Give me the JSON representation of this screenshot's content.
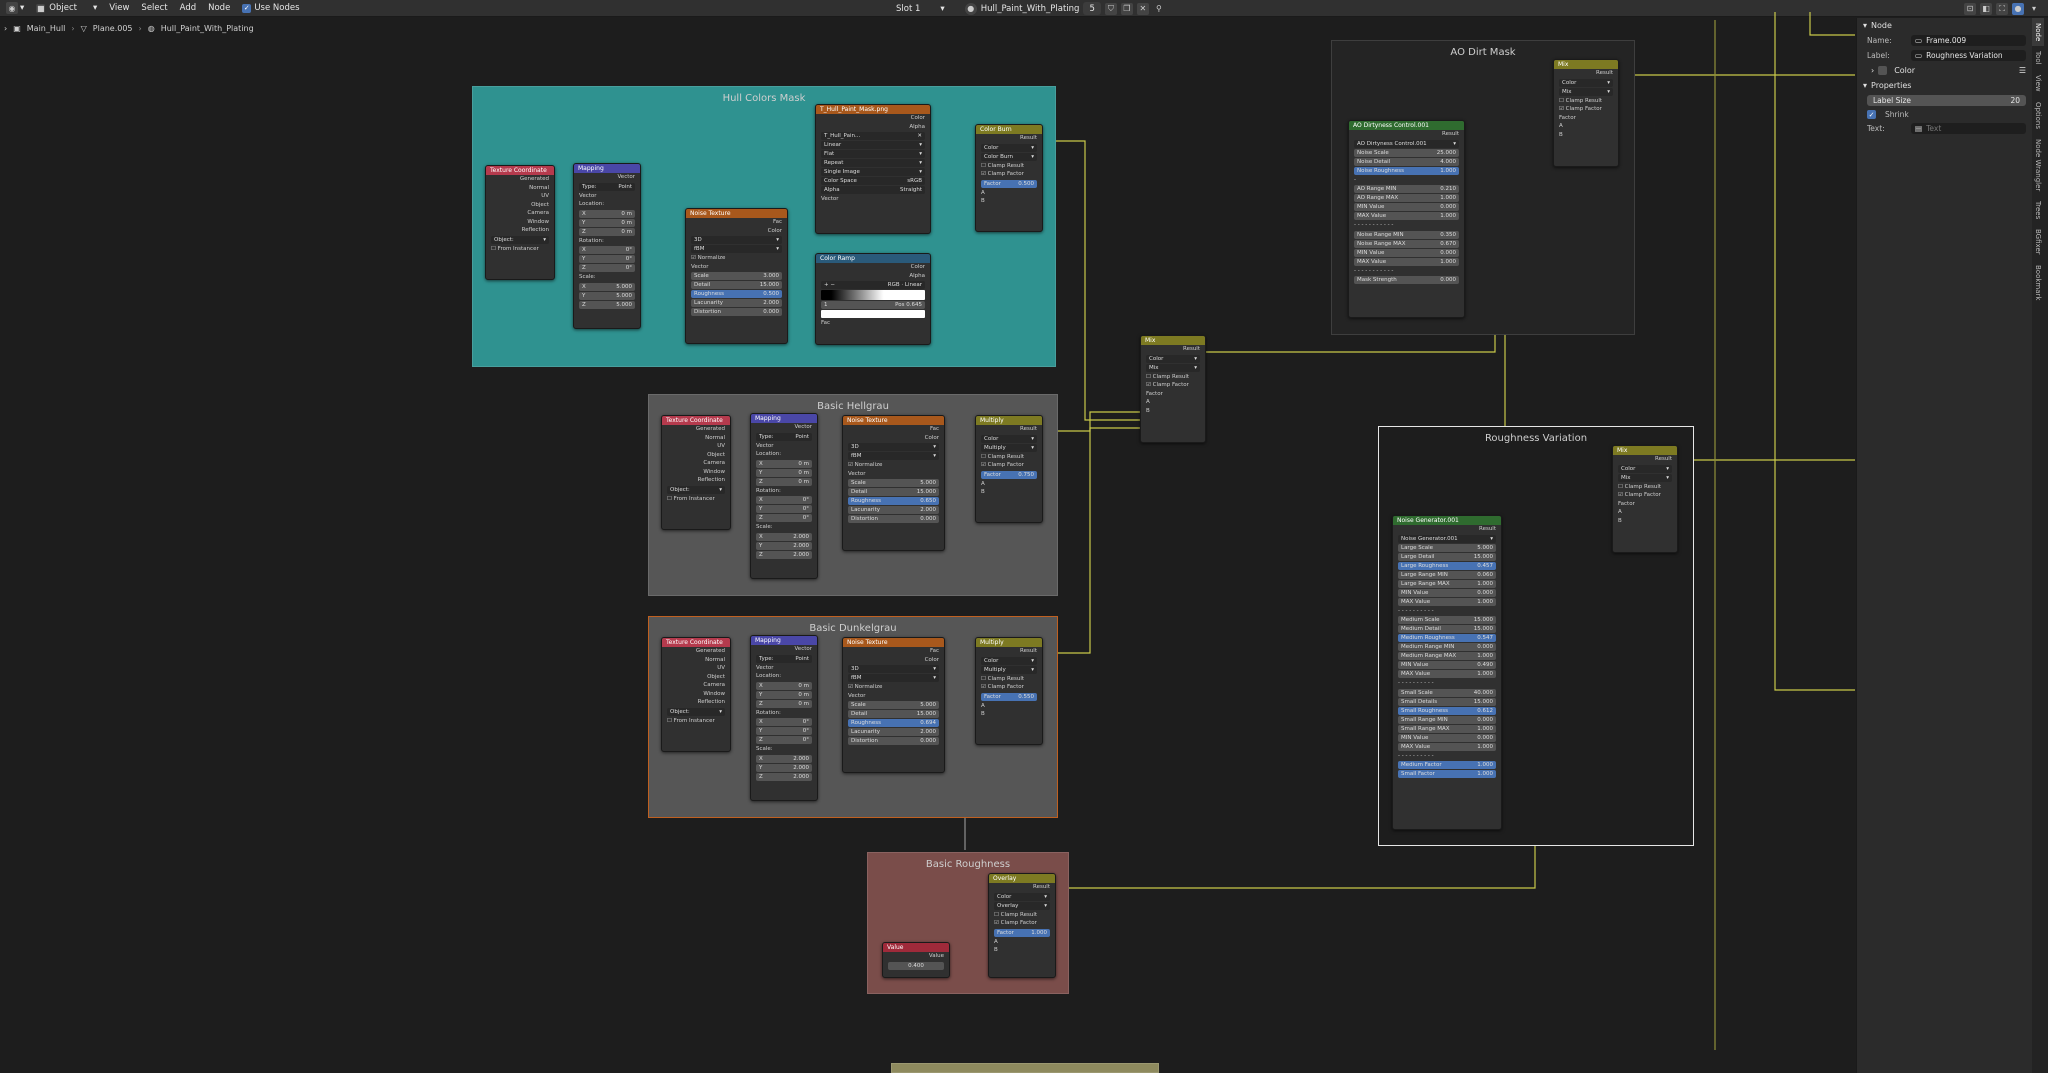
{
  "header": {
    "mode": "Object",
    "menus": [
      "View",
      "Select",
      "Add",
      "Node"
    ],
    "use_nodes_label": "Use Nodes",
    "slot": "Slot 1",
    "material": "Hull_Paint_With_Plating",
    "users": "5"
  },
  "breadcrumb": [
    "Main_Hull",
    "Plane.005",
    "Hull_Paint_With_Plating"
  ],
  "frames": {
    "hull_colors": "Hull Colors Mask",
    "hellgrau": "Basic Hellgrau",
    "dunkelgrau": "Basic Dunkelgrau",
    "roughness": "Basic Roughness",
    "ao": "AO Dirt Mask",
    "variation": "Roughness Variation"
  },
  "nodes": {
    "texcoord": "Texture Coordinate",
    "mapping": "Mapping",
    "noise": "Noise Texture",
    "image": "T_Hull_Paint_Mask.png",
    "ramp": "Color Ramp",
    "colorburn": "Color Burn",
    "multiply": "Multiply",
    "mix": "Mix",
    "overlay": "Overlay",
    "value": "Value",
    "value_val": "0.400",
    "ao_group": "AO Dirtyness Control.001",
    "noise_gen": "Noise Generator.001"
  },
  "sidebar": {
    "section": "Node",
    "name_label": "Name:",
    "name_value": "Frame.009",
    "label_label": "Label:",
    "label_value": "Roughness Variation",
    "color_label": "Color",
    "properties_label": "Properties",
    "label_size_label": "Label Size",
    "label_size_value": "20",
    "shrink_label": "Shrink",
    "text_label": "Text:",
    "text_placeholder": "Text"
  },
  "vtabs": [
    "Node",
    "Tool",
    "View",
    "Options",
    "Node Wrangler",
    "Trees",
    "BGfixer",
    "Bookmark"
  ]
}
